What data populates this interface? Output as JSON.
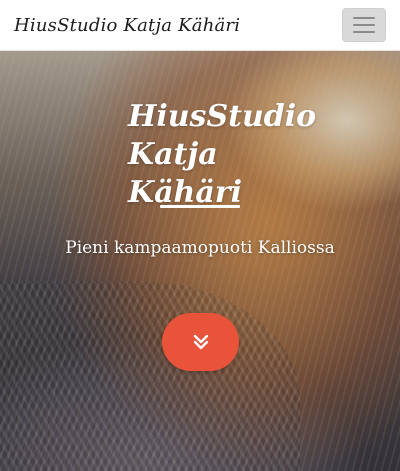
{
  "navbar": {
    "brand": "HiusStudio Katja Kähäri",
    "toggle_icon": "hamburger-menu-icon"
  },
  "hero": {
    "title_line1": "HiusStudio",
    "title_line2": "Katja Kähäri",
    "subtitle": "Pieni kampaamopuoti Kalliossa",
    "scroll_icon": "double-chevron-down-icon",
    "accent_color": "#e9533a"
  }
}
